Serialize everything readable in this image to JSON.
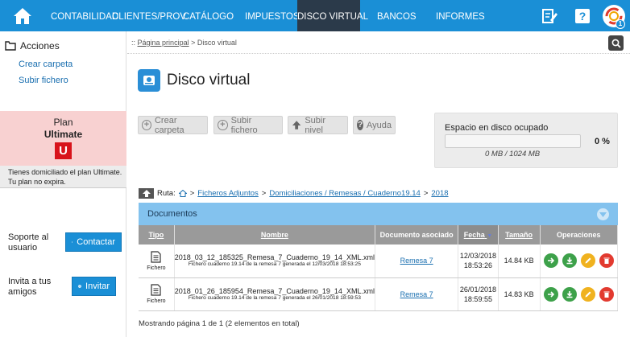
{
  "topnav": {
    "items": [
      "CONTABILIDAD",
      "CLIENTES/PROV.",
      "CATÁLOGO",
      "IMPUESTOS",
      "DISCO VIRTUAL",
      "BANCOS",
      "INFORMES"
    ],
    "active": "DISCO VIRTUAL",
    "notification_count": "1",
    "color": "#1a8fd6"
  },
  "sidebar": {
    "section_title": "Acciones",
    "links": [
      "Crear carpeta",
      "Subir fichero"
    ],
    "plan_label": "Plan",
    "plan_name": "Ultimate",
    "plan_badge": "U",
    "plan_status": "Tienes domiciliado el plan Ultimate. Tu plan no expira.",
    "support_text": "Soporte al usuario",
    "contact_button": "Contactar",
    "invite_text": "Invita a tus amigos",
    "invite_button": "Invitar"
  },
  "breadcrumb": {
    "home": "Página principal",
    "current": "Disco virtual",
    "prefix": "::"
  },
  "page_title": "Disco virtual",
  "toolbar": {
    "create_folder": "Crear carpeta",
    "upload_file": "Subir fichero",
    "up_level": "Subir nivel",
    "help": "Ayuda"
  },
  "disk": {
    "title": "Espacio en disco ocupado",
    "percent": "0 %",
    "used_fraction": 0,
    "usage": "0 MB / 1024 MB"
  },
  "ruta": {
    "label": "Ruta:",
    "parts": [
      "Ficheros Adjuntos",
      "Domiciliaciones / Remesas / Cuaderno19.14",
      "2018"
    ]
  },
  "documents": {
    "title": "Documentos",
    "headers": [
      "Tipo",
      "Nombre",
      "Documento asociado",
      "Fecha",
      "Tamaño",
      "Operaciones"
    ],
    "rows": [
      {
        "type": "Fichero",
        "name": "2018_03_12_185325_Remesa_7_Cuaderno_19_14_XML.xml",
        "desc": "Fichero cuaderno 19.14 de la remesa 7 generada el 12/03/2018 18:53:25",
        "assoc": "Remesa 7",
        "date": "12/03/2018",
        "time": "18:53:26",
        "size": "14.84 KB"
      },
      {
        "type": "Fichero",
        "name": "2018_01_26_185954_Remesa_7_Cuaderno_19_14_XML.xml",
        "desc": "Fichero cuaderno 19.14 de la remesa 7 generada el 26/01/2018 18:59:53",
        "assoc": "Remesa 7",
        "date": "26/01/2018",
        "time": "18:59:55",
        "size": "14.83 KB"
      }
    ],
    "footer": "Mostrando página 1 de 1 (2 elementos en total)"
  }
}
